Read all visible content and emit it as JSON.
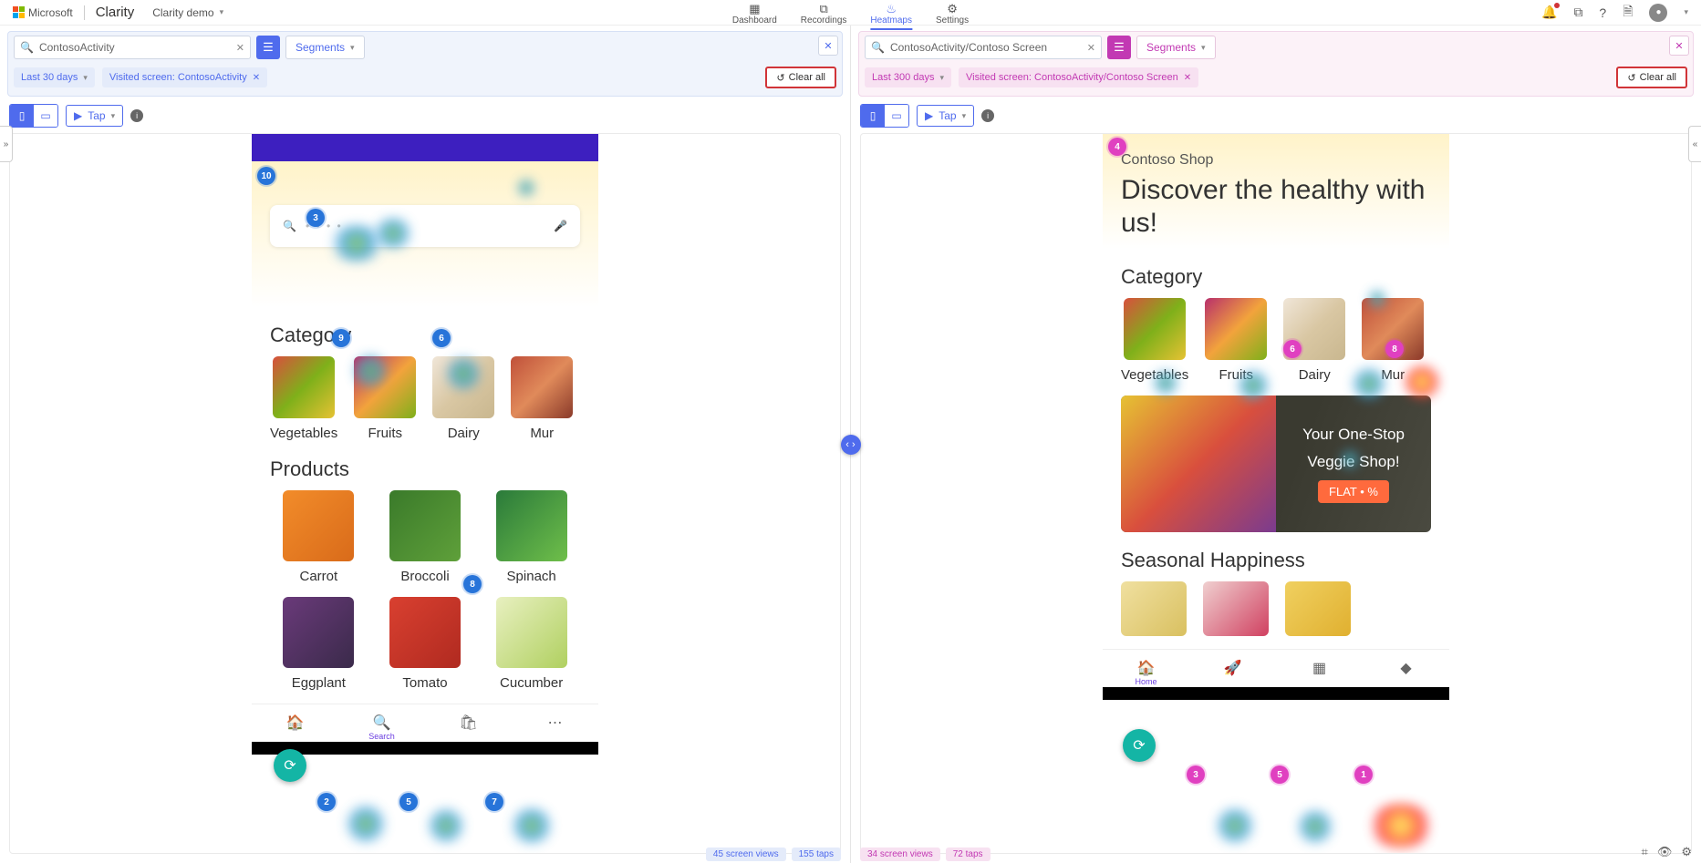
{
  "topnav": {
    "ms": "Microsoft",
    "brand": "Clarity",
    "demo": "Clarity demo",
    "tabs": {
      "dashboard": "Dashboard",
      "recordings": "Recordings",
      "heatmaps": "Heatmaps",
      "settings": "Settings"
    }
  },
  "left": {
    "search": "ContosoActivity",
    "segments": "Segments",
    "chips": {
      "date": "Last 30 days",
      "screen": "Visited screen: ContosoActivity"
    },
    "clear": "Clear all",
    "tap": "Tap",
    "markers": {
      "m10": "10",
      "m3": "3",
      "m9": "9",
      "m6": "6",
      "m8": "8",
      "m2": "2",
      "m5": "5",
      "m7": "7"
    },
    "stats": {
      "views": "45 screen views",
      "taps": "155 taps"
    }
  },
  "right": {
    "search": "ContosoActivity/Contoso Screen",
    "segments": "Segments",
    "chips": {
      "date": "Last 300 days",
      "screen": "Visited screen: ContosoActivity/Contoso Screen"
    },
    "clear": "Clear all",
    "tap": "Tap",
    "markers": {
      "m4": "4",
      "m6": "6",
      "m8": "8",
      "m3": "3",
      "m5": "5",
      "m1": "1"
    },
    "stats": {
      "views": "34 screen views",
      "taps": "72 taps"
    }
  },
  "app": {
    "shop_title": "Contoso Shop",
    "hero_line": "Discover the healthy with us!",
    "category": "Category",
    "products": "Products",
    "seasonal": "Seasonal Happiness",
    "cats": {
      "veg": "Vegetables",
      "fruit": "Fruits",
      "dairy": "Dairy",
      "mur": "Mur"
    },
    "prods": {
      "carrot": "Carrot",
      "broccoli": "Broccoli",
      "spinach": "Spinach",
      "eggplant": "Eggplant",
      "tomato": "Tomato",
      "cucumber": "Cucumber"
    },
    "banner": {
      "l1": "Your One-Stop",
      "l2": "Veggie Shop!",
      "flat": "FLAT • %"
    },
    "tabs": {
      "home": "Home",
      "search": "Search"
    }
  }
}
